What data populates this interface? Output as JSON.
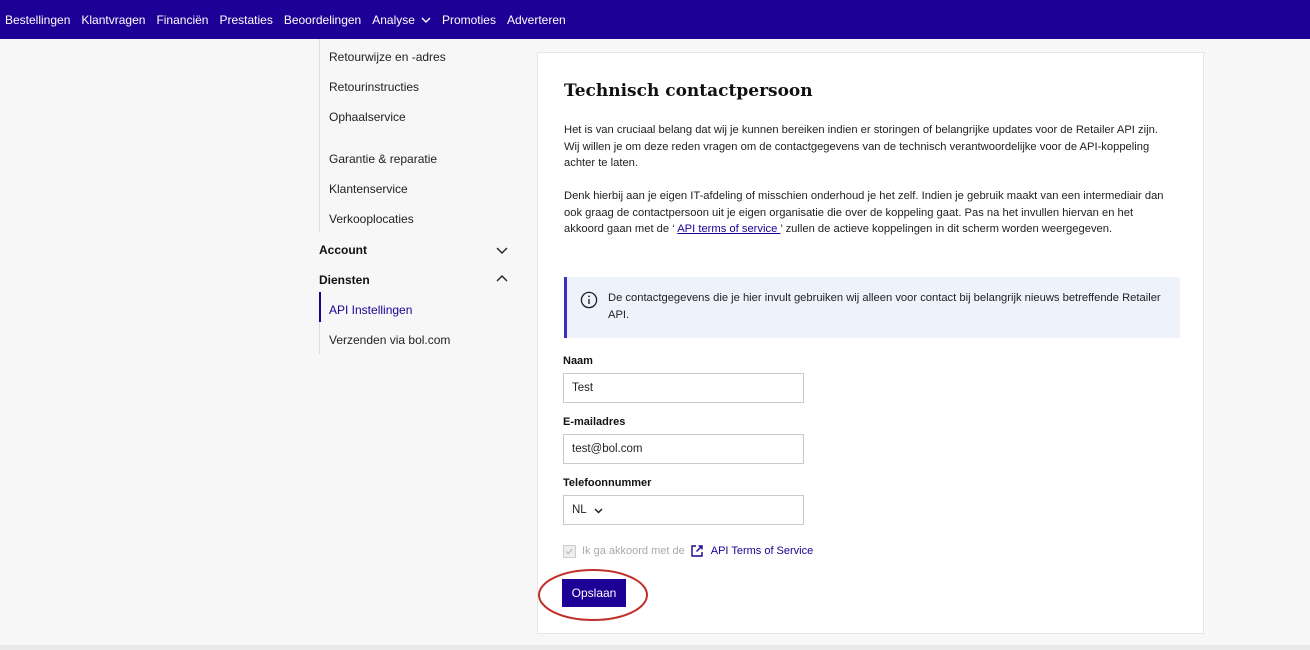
{
  "topnav": {
    "items": [
      "Bestellingen",
      "Klantvragen",
      "Financiën",
      "Prestaties",
      "Beoordelingen",
      "Analyse",
      "Promoties",
      "Adverteren"
    ]
  },
  "sidebar": {
    "items": [
      "Retourwijze en -adres",
      "Retourinstructies",
      "Ophaalservice",
      "Garantie & reparatie",
      "Klantenservice",
      "Verkooplocaties"
    ],
    "account_heading": "Account",
    "diensten_heading": "Diensten",
    "diensten_items": [
      "API Instellingen",
      "Verzenden via bol.com"
    ],
    "active_item": "API Instellingen"
  },
  "main": {
    "title": "Technisch contactpersoon",
    "para1": "Het is van cruciaal belang dat wij je kunnen bereiken indien er storingen of belangrijke updates voor de Retailer API zijn. Wij willen je om deze reden vragen om de contactgegevens van de technisch verantwoordelijke voor de API-koppeling achter te laten.",
    "para2_before": "Denk hierbij aan je eigen IT-afdeling of misschien onderhoud je het zelf. Indien je gebruik maakt van een intermediair dan ook graag de contactpersoon uit je eigen organisatie die over de koppeling gaat. Pas na het invullen hiervan en het akkoord gaan met de ‘ ",
    "para2_link": "API terms of service ",
    "para2_after": "’ zullen de actieve koppelingen in dit scherm worden weergegeven.",
    "info_text": "De contactgegevens die je hier invult gebruiken wij alleen voor contact bij belangrijk nieuws betreffende Retailer API.",
    "form": {
      "name_label": "Naam",
      "name_value": "Test",
      "email_label": "E-mailadres",
      "email_value": "test@bol.com",
      "phone_label": "Telefoonnummer",
      "phone_country": "NL"
    },
    "consent_text": "Ik ga akkoord met de",
    "consent_link": "API Terms of Service",
    "save_label": "Opslaan"
  },
  "colors": {
    "brand": "#1d0095",
    "annotation": "#c0302a"
  }
}
